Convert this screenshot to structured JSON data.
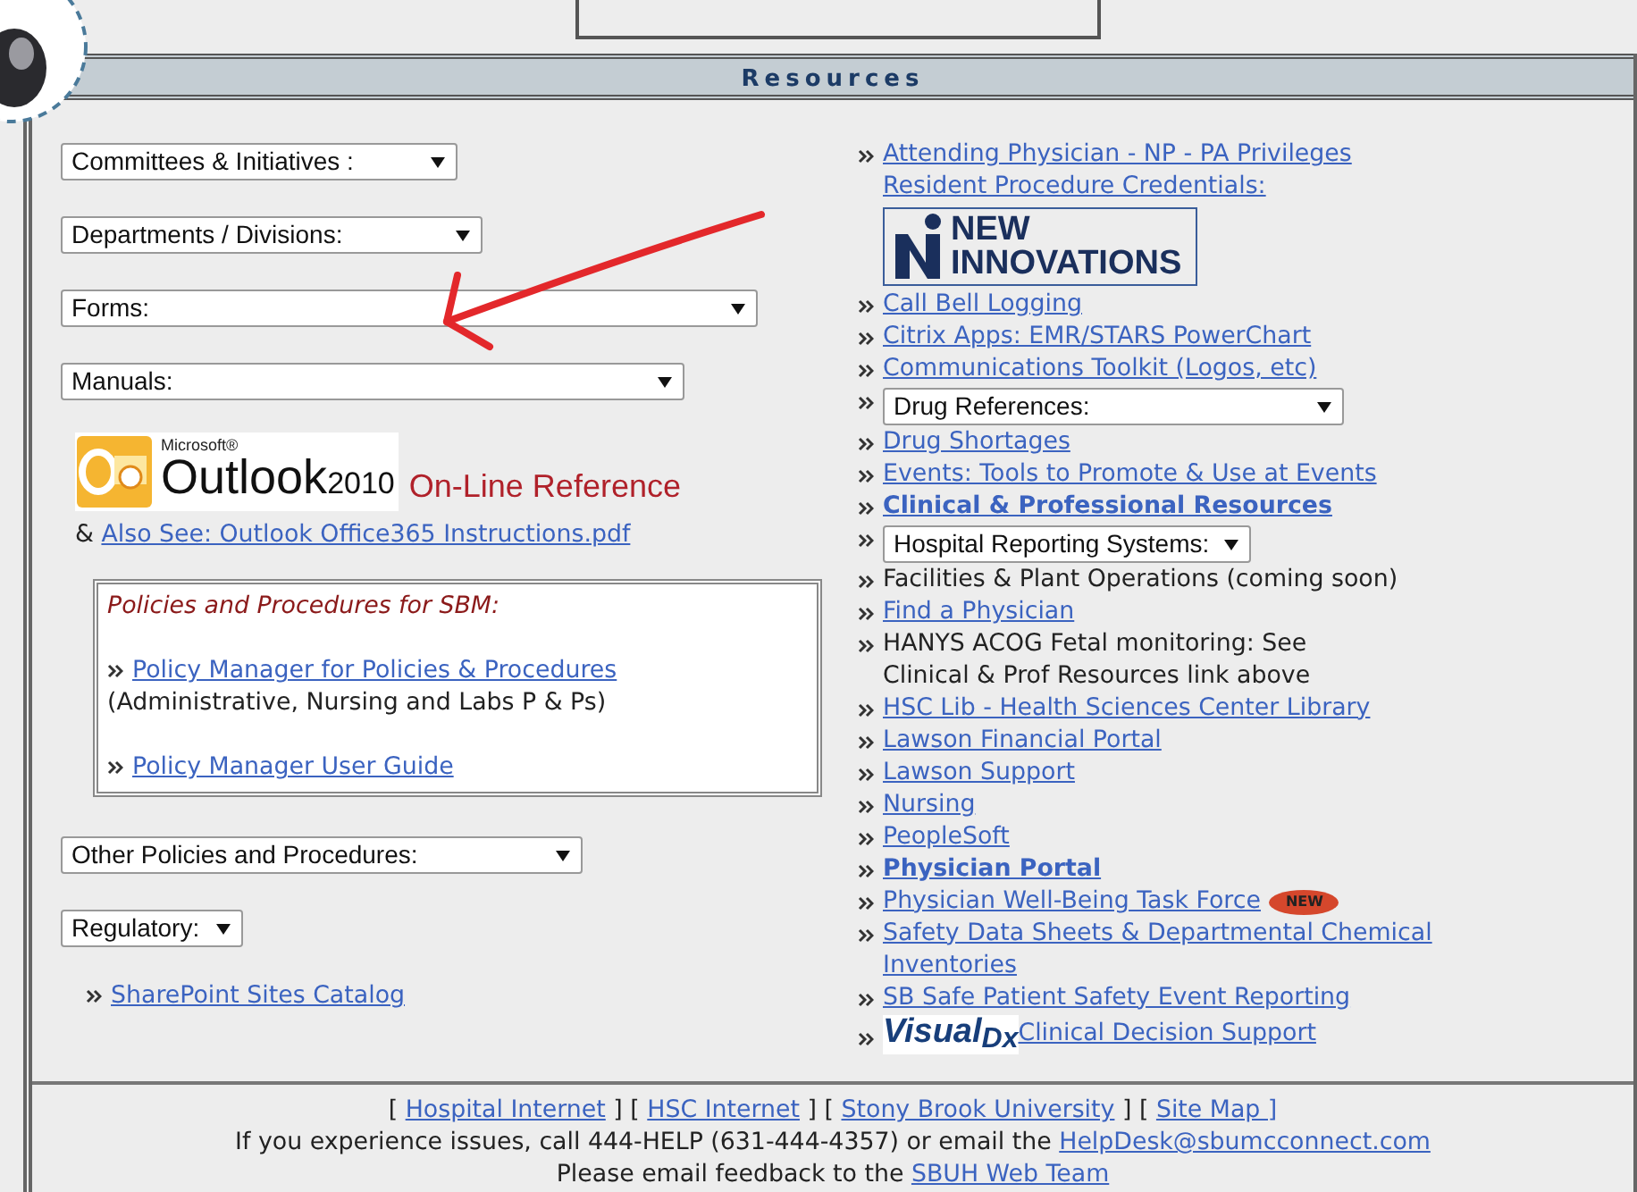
{
  "header": {
    "title": "Resources"
  },
  "left": {
    "dropdowns_top": [
      {
        "label": "Committees & Initiatives :"
      },
      {
        "label": "Departments / Divisions:"
      },
      {
        "label": "Forms:"
      },
      {
        "label": "Manuals:"
      }
    ],
    "outlook": {
      "brand": "Microsoft®",
      "product": "Outlook",
      "version": "2010",
      "caption": "On-Line Reference"
    },
    "also_see": {
      "prefix": "&",
      "link": "Also See: Outlook Office365 Instructions.pdf"
    },
    "policies": {
      "title": "Policies and Procedures for SBM:",
      "items": [
        {
          "kind": "link",
          "text": "Policy Manager for Policies & Procedures",
          "note": "(Administrative, Nursing and Labs P & Ps)"
        },
        {
          "kind": "link",
          "text": "Policy Manager User Guide"
        }
      ]
    },
    "dropdowns_bottom": [
      {
        "label": "Other Policies and Procedures:"
      },
      {
        "label": "Regulatory:"
      }
    ],
    "sharepoint": "SharePoint Sites Catalog"
  },
  "right": {
    "items": [
      {
        "kind": "link",
        "text": "Attending Physician - NP - PA Privileges"
      },
      {
        "kind": "sublink",
        "text": "Resident Procedure Credentials:"
      },
      {
        "kind": "ni_logo",
        "top": "NEW",
        "bottom": "INNOVATIONS"
      },
      {
        "kind": "link",
        "text": "Call Bell Logging"
      },
      {
        "kind": "link",
        "text": "Citrix Apps: EMR/STARS PowerChart"
      },
      {
        "kind": "link",
        "text": "Communications Toolkit (Logos, etc)"
      },
      {
        "kind": "dropdown",
        "text": "Drug References:"
      },
      {
        "kind": "link",
        "text": "Drug Shortages"
      },
      {
        "kind": "link",
        "text": "Events: Tools to Promote & Use at Events"
      },
      {
        "kind": "bold_link",
        "text": "Clinical & Professional Resources"
      },
      {
        "kind": "dropdown",
        "text": "Hospital Reporting Systems:"
      },
      {
        "kind": "text",
        "text": "Facilities & Plant Operations (coming soon)"
      },
      {
        "kind": "link",
        "text": "Find a Physician"
      },
      {
        "kind": "text",
        "text": "HANYS ACOG Fetal monitoring: See\nClinical & Prof Resources link above"
      },
      {
        "kind": "link",
        "text": "HSC Lib - Health Sciences Center Library"
      },
      {
        "kind": "link",
        "text": "Lawson Financial Portal"
      },
      {
        "kind": "link",
        "text": "Lawson Support"
      },
      {
        "kind": "link",
        "text": "Nursing"
      },
      {
        "kind": "link",
        "text": "PeopleSoft"
      },
      {
        "kind": "bold_link",
        "text": "Physician Portal"
      },
      {
        "kind": "link",
        "text": "Physician Well-Being Task Force",
        "badge": "NEW"
      },
      {
        "kind": "link",
        "text": "Safety Data Sheets & Departmental Chemical\nInventories"
      },
      {
        "kind": "link",
        "text": "SB Safe Patient Safety Event Reporting"
      },
      {
        "kind": "vdx_link",
        "logo": "Visual",
        "logo_mark": "Dx",
        "text": " Clinical Decision Support"
      }
    ]
  },
  "footer": {
    "lines": [
      [
        {
          "kind": "text",
          "text": "["
        },
        {
          "kind": "link",
          "text": "Hospital Internet"
        },
        {
          "kind": "text",
          "text": "]  ["
        },
        {
          "kind": "link",
          "text": "HSC Internet"
        },
        {
          "kind": "text",
          "text": "]  ["
        },
        {
          "kind": "link",
          "text": "Stony Brook University"
        },
        {
          "kind": "text",
          "text": "]  ["
        },
        {
          "kind": "link",
          "text": "Site Map ]"
        }
      ],
      [
        {
          "kind": "text",
          "text": "If you experience issues, call 444-HELP (631-444-4357) or email the"
        },
        {
          "kind": "link",
          "text": "HelpDesk@sbumcconnect.com"
        }
      ],
      [
        {
          "kind": "text",
          "text": "Please email feedback to the"
        },
        {
          "kind": "link",
          "text": "SBUH Web Team"
        }
      ]
    ]
  }
}
